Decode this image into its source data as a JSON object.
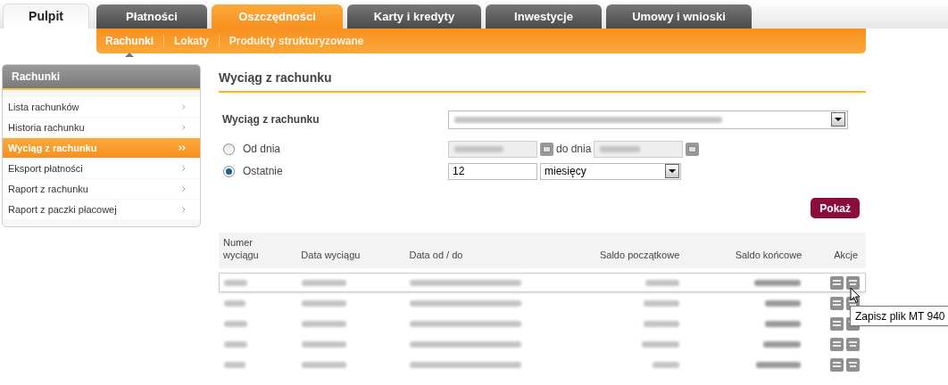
{
  "home_tab": {
    "label": "Pulpit"
  },
  "tabs": [
    {
      "label": "Płatności",
      "selected": false
    },
    {
      "label": "Oszczędności",
      "selected": true
    },
    {
      "label": "Karty i kredyty",
      "selected": false
    },
    {
      "label": "Inwestycje",
      "selected": false
    },
    {
      "label": "Umowy i wnioski",
      "selected": false
    }
  ],
  "subtabs": [
    {
      "label": "Rachunki",
      "selected": true
    },
    {
      "label": "Lokaty",
      "selected": false
    },
    {
      "label": "Produkty strukturyzowane",
      "selected": false
    }
  ],
  "sidebar": {
    "title": "Rachunki",
    "items": [
      {
        "label": "Lista rachunków",
        "selected": false
      },
      {
        "label": "Historia rachunku",
        "selected": false
      },
      {
        "label": "Wyciąg z rachunku",
        "selected": true
      },
      {
        "label": "Eksport płatności",
        "selected": false
      },
      {
        "label": "Raport z rachunku",
        "selected": false
      },
      {
        "label": "Raport z paczki płacowej",
        "selected": false
      }
    ]
  },
  "page_title": "Wyciąg z rachunku",
  "form": {
    "account_label": "Wyciąg z rachunku",
    "range_options": [
      {
        "label": "Od dnia",
        "selected": false
      },
      {
        "label": "Ostatnie",
        "selected": true
      }
    ],
    "to_label": "do dnia",
    "count_value": "12",
    "unit_value": "miesięcy",
    "submit": "Pokaż"
  },
  "table": {
    "columns": [
      "Numer\nwyciągu",
      "Data wyciągu",
      "Data od / do",
      "Saldo początkowe",
      "Saldo końcowe",
      "Akcje"
    ],
    "rows": [
      {
        "selected": true
      },
      {
        "selected": false
      },
      {
        "selected": false
      },
      {
        "selected": false
      },
      {
        "selected": false
      }
    ]
  },
  "tooltip": "Zapisz plik MT 940"
}
